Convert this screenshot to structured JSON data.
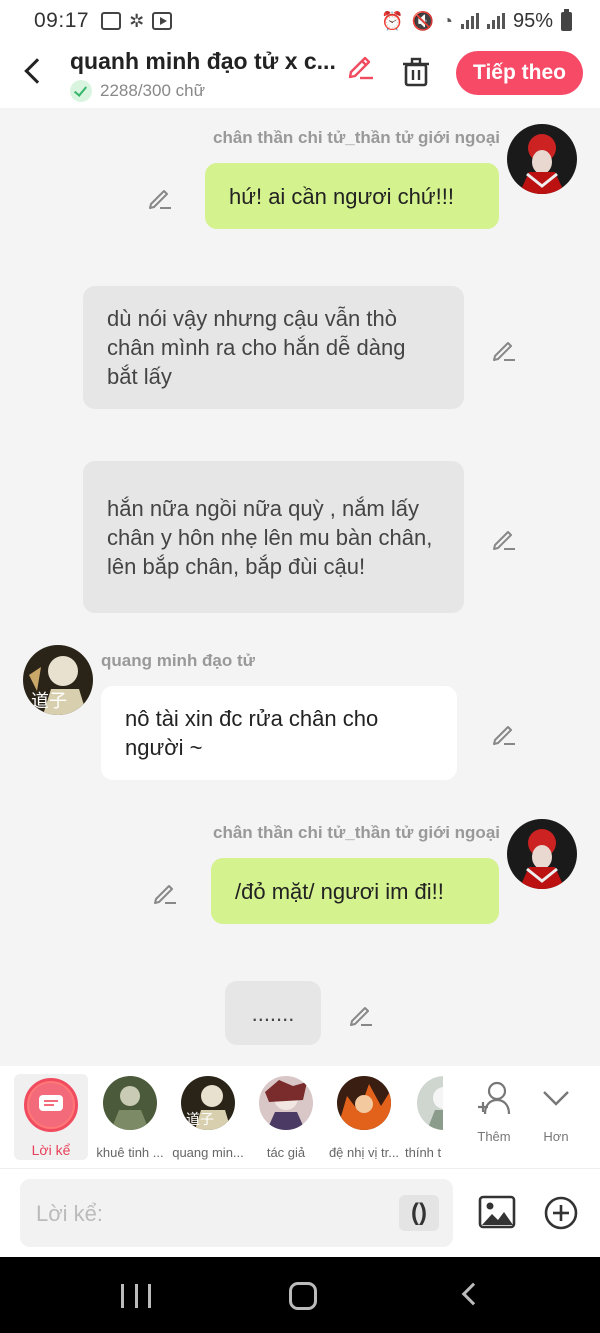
{
  "status_bar": {
    "time": "09:17",
    "battery": "95%"
  },
  "header": {
    "title": "quanh minh đạo tử x c...",
    "word_count": "2288/300 chữ",
    "next_label": "Tiếp theo"
  },
  "messages": [
    {
      "type": "right",
      "name": "chân thần chi tử_thần tử giới ngoại",
      "text": "hứ! ai cần ngươi chứ!!!"
    },
    {
      "type": "narration",
      "text": "dù nói vậy nhưng cậu vẫn thò chân mình ra cho hắn dễ dàng bắt lấy"
    },
    {
      "type": "narration",
      "text": "hắn nữa ngồi nữa quỳ , nắm lấy chân y hôn nhẹ lên mu bàn chân, lên bắp chân, bắp đùi cậu!"
    },
    {
      "type": "left",
      "name": "quang minh đạo tử",
      "text": "nô tài xin đc rửa chân cho người ~"
    },
    {
      "type": "right",
      "name": "chân thần chi tử_thần tử giới ngoại",
      "text": "/đỏ mặt/ ngươi im đi!!"
    },
    {
      "type": "narration",
      "text": "......."
    }
  ],
  "character_bar": {
    "narrator_label": "Lời kể",
    "characters": [
      {
        "label": "khuê tinh ..."
      },
      {
        "label": "quang min..."
      },
      {
        "label": "tác giả"
      },
      {
        "label": "đệ nhị vị tr..."
      },
      {
        "label": "thính t"
      }
    ],
    "add_label": "Thêm",
    "more_label": "Hơn"
  },
  "input": {
    "placeholder": "Lời kể:",
    "paren_label": "()"
  },
  "colors": {
    "accent": "#f74a66",
    "green_bubble": "#d4f28e",
    "gray_bubble": "#e6e6e6"
  }
}
